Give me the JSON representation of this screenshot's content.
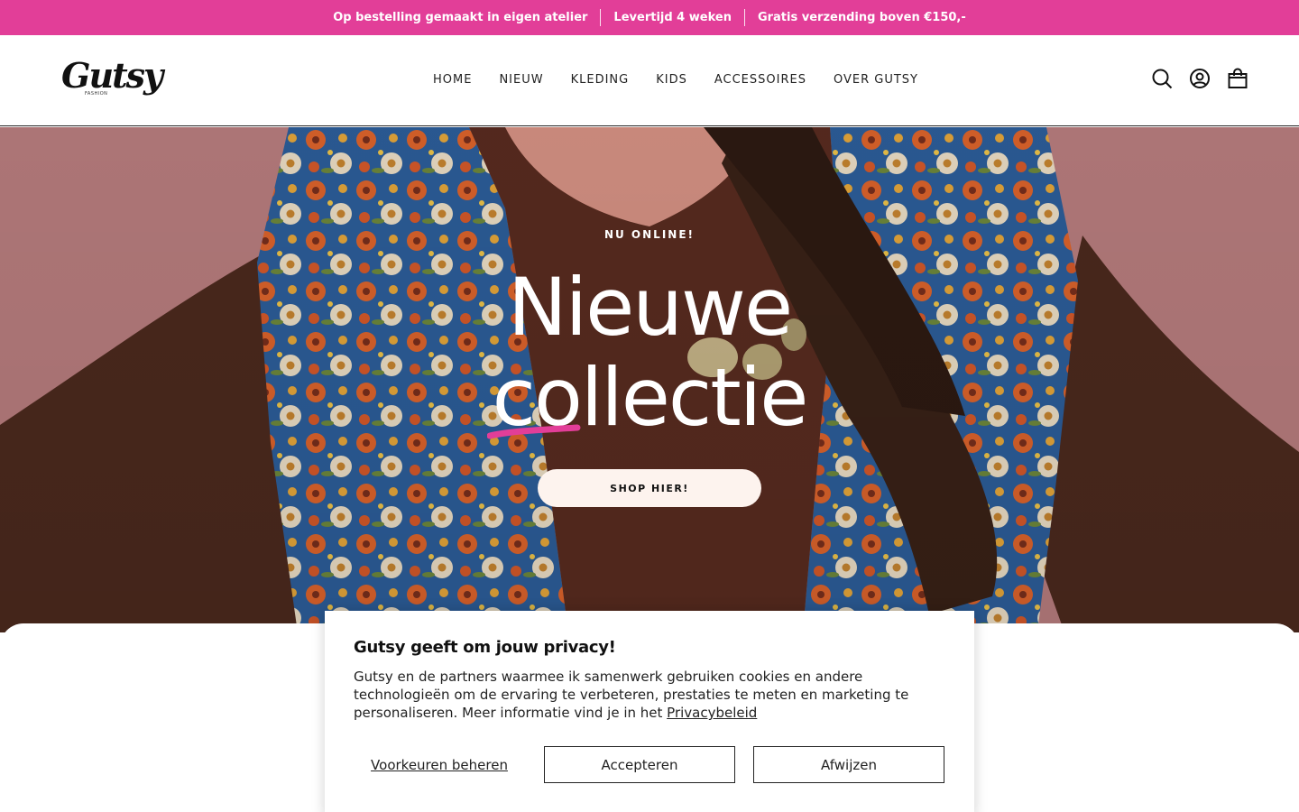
{
  "announcement": {
    "items": [
      "Op bestelling gemaakt in eigen atelier",
      "Levertijd 4 weken",
      "Gratis verzending boven €150,-"
    ],
    "color": "#e23e98"
  },
  "header": {
    "logo_text": "Gutsy",
    "logo_sub": "FASHION",
    "nav": [
      "HOME",
      "NIEUW",
      "KLEDING",
      "KIDS",
      "ACCESSOIRES",
      "OVER GUTSY"
    ],
    "icons": [
      "search-icon",
      "account-icon",
      "cart-icon"
    ]
  },
  "hero": {
    "eyebrow": "NU ONLINE!",
    "title_line1": "Nieuwe",
    "title_line2": "collectie",
    "button": "SHOP HIER!",
    "underline_color": "#e23e98"
  },
  "cookie": {
    "title": "Gutsy geeft om jouw privacy!",
    "text": "Gutsy en de partners waarmee ik samenwerk gebruiken cookies en andere technologieën om de ervaring te verbeteren, prestaties te meten en marketing te personaliseren. Meer informatie vind je in het ",
    "link": "Privacybeleid",
    "prefs": "Voorkeuren beheren",
    "accept": "Accepteren",
    "decline": "Afwijzen"
  }
}
